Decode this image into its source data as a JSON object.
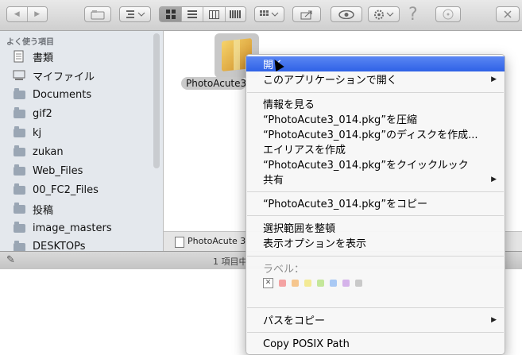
{
  "toolbar": {
    "back_icon": "◀",
    "forward_icon": "▶",
    "help_icon": "?"
  },
  "sidebar": {
    "heading": "よく使う項目",
    "items": [
      {
        "label": "書類",
        "icon": "documents-icon"
      },
      {
        "label": "マイファイル",
        "icon": "all-my-files-icon"
      },
      {
        "label": "Documents",
        "icon": "folder-icon"
      },
      {
        "label": "gif2",
        "icon": "folder-icon"
      },
      {
        "label": "kj",
        "icon": "folder-icon"
      },
      {
        "label": "zukan",
        "icon": "folder-icon"
      },
      {
        "label": "Web_Files",
        "icon": "folder-icon"
      },
      {
        "label": "00_FC2_Files",
        "icon": "folder-icon"
      },
      {
        "label": "投稿",
        "icon": "folder-icon"
      },
      {
        "label": "image_masters",
        "icon": "folder-icon"
      },
      {
        "label": "DESKTOPs",
        "icon": "folder-icon"
      }
    ]
  },
  "content": {
    "file_name": "PhotoAcute3_0",
    "path_item": "PhotoAcute 3"
  },
  "status_bar": {
    "text": "1 項目中"
  },
  "context_menu": {
    "open": "開く",
    "open_with": "このアプリケーションで開く",
    "get_info": "情報を見る",
    "compress": "“PhotoAcute3_014.pkg”を圧縮",
    "burn": "“PhotoAcute3_014.pkg”のディスクを作成...",
    "make_alias": "エイリアスを作成",
    "quick_look": "“PhotoAcute3_014.pkg”をクイックルック",
    "share": "共有",
    "copy": "“PhotoAcute3_014.pkg”をコピー",
    "clean_up": "選択範囲を整頓",
    "view_options": "表示オプションを表示",
    "label_heading": "ラベル：",
    "label_colors": [
      "#f4a3a3",
      "#f6c68e",
      "#f3ea95",
      "#c4e79a",
      "#a9c9f4",
      "#d5b3ea",
      "#c9c9c9"
    ],
    "copy_path": "パスをコピー",
    "copy_posix": "Copy POSIX Path"
  }
}
